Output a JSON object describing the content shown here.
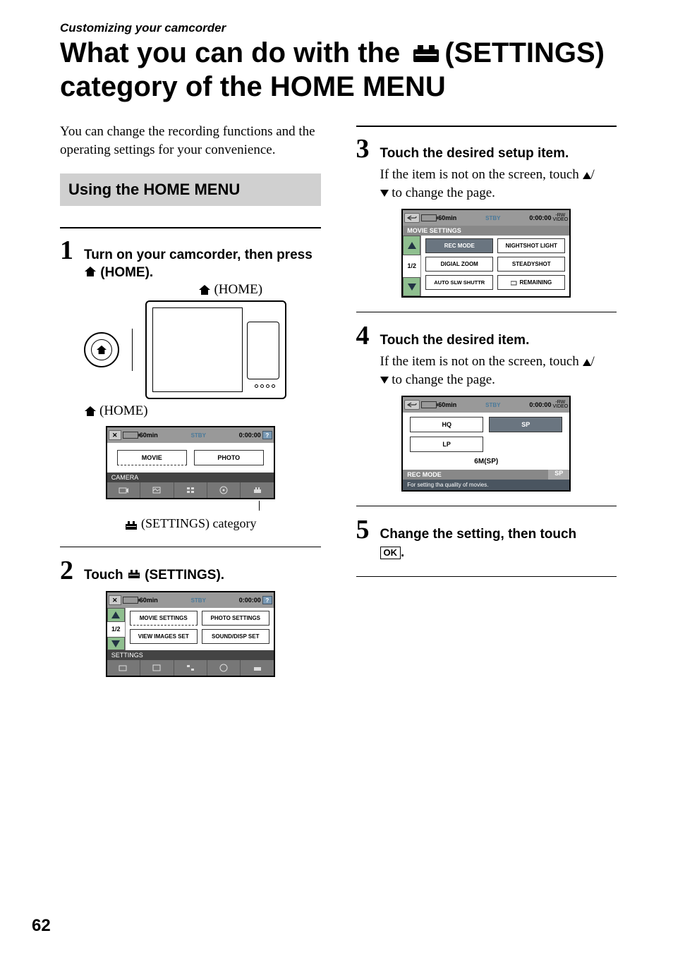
{
  "breadcrumb": "Customizing your camcorder",
  "title_part1": "What you can do with the ",
  "title_part2": "(SETTINGS) category of the HOME MENU",
  "intro": "You can change the recording functions and the operating settings for your convenience.",
  "section_heading": "Using the HOME MENU",
  "steps": {
    "s1": {
      "num": "1",
      "text_a": "Turn on your camcorder, then press ",
      "text_b": " (HOME)."
    },
    "s2": {
      "num": "2",
      "text_a": "Touch ",
      "text_b": " (SETTINGS)."
    },
    "s3": {
      "num": "3",
      "text": "Touch the desired setup item.",
      "desc_a": "If the item is not on the screen, touch ",
      "desc_b": "/",
      "desc_c": " to change the page."
    },
    "s4": {
      "num": "4",
      "text": "Touch the desired item.",
      "desc_a": "If the item is not on the screen, touch ",
      "desc_b": "/",
      "desc_c": " to change the page."
    },
    "s5": {
      "num": "5",
      "text_a": "Change the setting, then touch ",
      "text_b": "."
    }
  },
  "labels": {
    "home_top": "(HOME)",
    "home_bottom": "(HOME)",
    "settings_caption": "(SETTINGS) category",
    "ok": "OK"
  },
  "lcd1": {
    "batt_time": "60min",
    "stby": "STBY",
    "timer": "0:00:00",
    "btn1": "MOVIE",
    "btn2": "PHOTO",
    "catlabel": "CAMERA"
  },
  "lcd2": {
    "batt_time": "60min",
    "stby": "STBY",
    "timer": "0:00:00",
    "b1": "MOVIE SETTINGS",
    "b2": "PHOTO SETTINGS",
    "b3": "VIEW IMAGES SET",
    "b4": "SOUND/DISP SET",
    "page": "1/2",
    "catlabel": "SETTINGS"
  },
  "lcd3": {
    "batt_time": "60min",
    "stby": "STBY",
    "timer": "0:00:00",
    "disc": "-RW\nVIDEO",
    "header": "MOVIE SETTINGS",
    "b1": "REC MODE",
    "b2": "NIGHTSHOT LIGHT",
    "b3": "DIGIAL ZOOM",
    "b4": "STEADYSHOT",
    "b5": "AUTO SLW SHUTTR",
    "b6": "REMAINING",
    "page": "1/2"
  },
  "lcd4": {
    "batt_time": "60min",
    "stby": "STBY",
    "timer": "0:00:00",
    "disc": "-RW\nVIDEO",
    "b1": "HQ",
    "b2": "SP",
    "b3": "LP",
    "mid": "6M(SP)",
    "rec": "REC MODE",
    "sp": "SP",
    "footer": "For setting tha quality of movies."
  },
  "page_number": "62"
}
